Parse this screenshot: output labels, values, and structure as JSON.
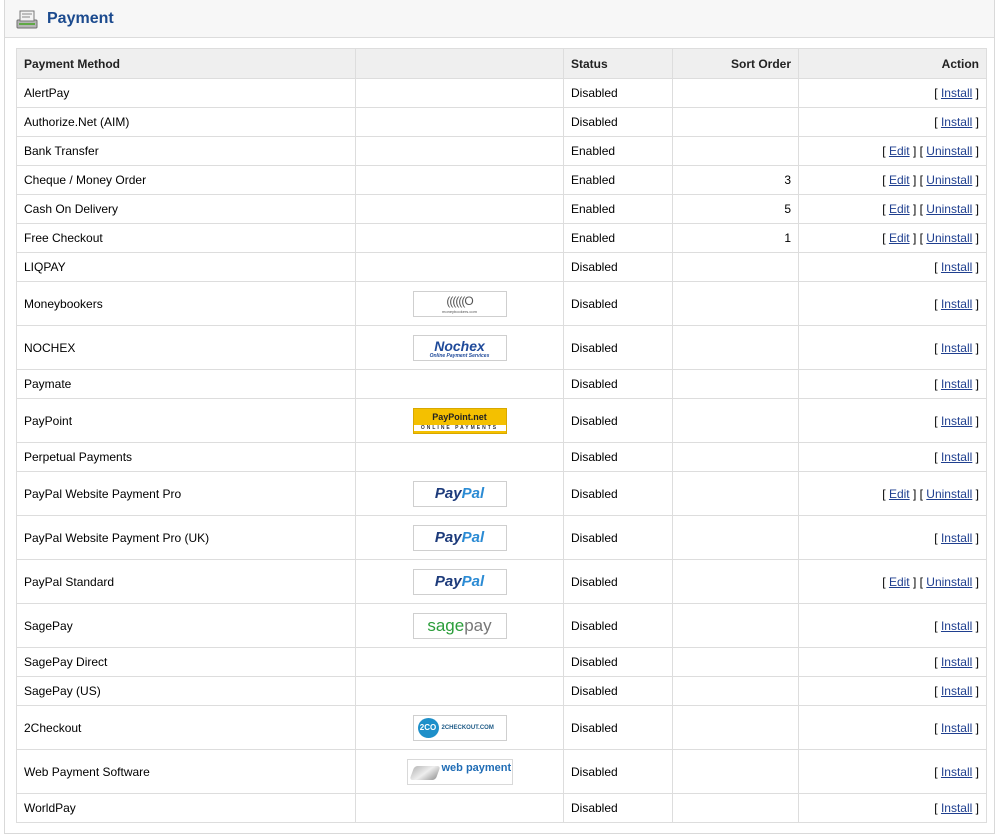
{
  "page": {
    "title": "Payment"
  },
  "table": {
    "headers": {
      "method": "Payment Method",
      "logo": "",
      "status": "Status",
      "sort": "Sort Order",
      "action": "Action"
    },
    "links": {
      "install": "Install",
      "edit": "Edit",
      "uninstall": "Uninstall"
    },
    "rows": [
      {
        "name": "AlertPay",
        "logo": "",
        "status": "Disabled",
        "sort": "",
        "installed": false
      },
      {
        "name": "Authorize.Net (AIM)",
        "logo": "",
        "status": "Disabled",
        "sort": "",
        "installed": false
      },
      {
        "name": "Bank Transfer",
        "logo": "",
        "status": "Enabled",
        "sort": "",
        "installed": true
      },
      {
        "name": "Cheque / Money Order",
        "logo": "",
        "status": "Enabled",
        "sort": "3",
        "installed": true
      },
      {
        "name": "Cash On Delivery",
        "logo": "",
        "status": "Enabled",
        "sort": "5",
        "installed": true
      },
      {
        "name": "Free Checkout",
        "logo": "",
        "status": "Enabled",
        "sort": "1",
        "installed": true
      },
      {
        "name": "LIQPAY",
        "logo": "",
        "status": "Disabled",
        "sort": "",
        "installed": false
      },
      {
        "name": "Moneybookers",
        "logo": "moneybookers",
        "status": "Disabled",
        "sort": "",
        "installed": false
      },
      {
        "name": "NOCHEX",
        "logo": "nochex",
        "status": "Disabled",
        "sort": "",
        "installed": false
      },
      {
        "name": "Paymate",
        "logo": "",
        "status": "Disabled",
        "sort": "",
        "installed": false
      },
      {
        "name": "PayPoint",
        "logo": "paypoint",
        "status": "Disabled",
        "sort": "",
        "installed": false
      },
      {
        "name": "Perpetual Payments",
        "logo": "",
        "status": "Disabled",
        "sort": "",
        "installed": false
      },
      {
        "name": "PayPal Website Payment Pro",
        "logo": "paypal",
        "status": "Disabled",
        "sort": "",
        "installed": true
      },
      {
        "name": "PayPal Website Payment Pro (UK)",
        "logo": "paypal",
        "status": "Disabled",
        "sort": "",
        "installed": false
      },
      {
        "name": "PayPal Standard",
        "logo": "paypal",
        "status": "Disabled",
        "sort": "",
        "installed": true
      },
      {
        "name": "SagePay",
        "logo": "sagepay",
        "status": "Disabled",
        "sort": "",
        "installed": false
      },
      {
        "name": "SagePay Direct",
        "logo": "",
        "status": "Disabled",
        "sort": "",
        "installed": false
      },
      {
        "name": "SagePay (US)",
        "logo": "",
        "status": "Disabled",
        "sort": "",
        "installed": false
      },
      {
        "name": "2Checkout",
        "logo": "2checkout",
        "status": "Disabled",
        "sort": "",
        "installed": false
      },
      {
        "name": "Web Payment Software",
        "logo": "webpaymentsoftware",
        "status": "Disabled",
        "sort": "",
        "installed": false
      },
      {
        "name": "WorldPay",
        "logo": "",
        "status": "Disabled",
        "sort": "",
        "installed": false
      }
    ]
  },
  "logos": {
    "paypal": {
      "text1": "Pay",
      "text2": "Pal"
    },
    "nochex": {
      "text": "Nochex",
      "sub": "Online Payment Services"
    },
    "paypoint": {
      "text": "PayPoint.net",
      "sub": "ONLINE PAYMENTS"
    },
    "sagepay": {
      "text1": "sage",
      "text2": "pay"
    },
    "moneybookers": {
      "text": "((((((O",
      "sub": "moneybookers.com"
    },
    "2checkout": {
      "badge": "2CO",
      "text": "2CHECKOUT.COM"
    },
    "webpaymentsoftware": {
      "text": "web payment software"
    }
  },
  "icons": {
    "heading": "payment-icon"
  }
}
